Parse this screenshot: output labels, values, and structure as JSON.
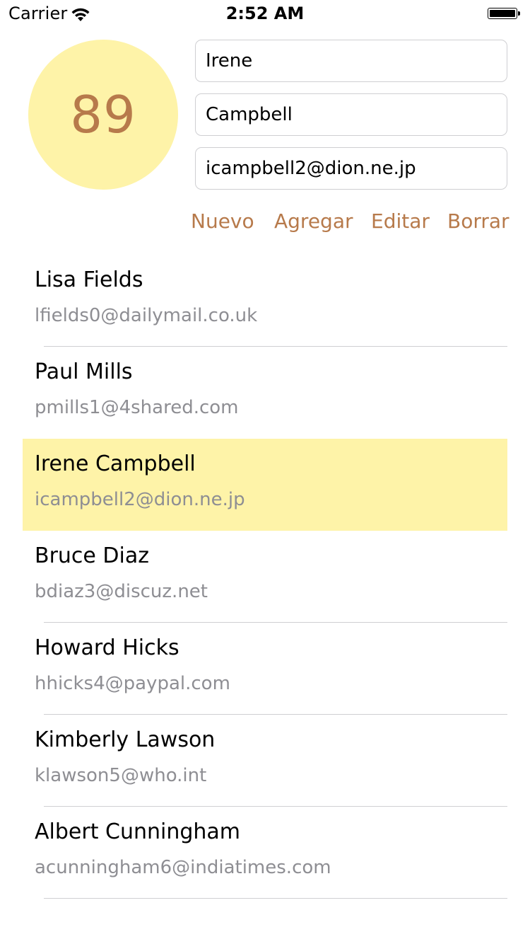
{
  "status_bar": {
    "carrier": "Carrier",
    "time": "2:52 AM",
    "wifi_icon": "wifi-icon",
    "battery_icon": "battery-icon",
    "battery_level": 1.0
  },
  "colors": {
    "accent": "#b77a4b",
    "highlight": "#fef3a8",
    "secondary_text": "#8e8e93",
    "separator": "#cfcfd2"
  },
  "avatar": {
    "number": "89"
  },
  "form": {
    "first_name": "Irene",
    "last_name": "Campbell",
    "email": "icampbell2@dion.ne.jp"
  },
  "actions": {
    "new_label": "Nuevo",
    "add_label": "Agregar",
    "edit_label": "Editar",
    "delete_label": "Borrar"
  },
  "contacts": [
    {
      "name": "Lisa Fields",
      "email": "lfields0@dailymail.co.uk",
      "selected": false
    },
    {
      "name": "Paul Mills",
      "email": "pmills1@4shared.com",
      "selected": false
    },
    {
      "name": "Irene Campbell",
      "email": "icampbell2@dion.ne.jp",
      "selected": true
    },
    {
      "name": "Bruce Diaz",
      "email": "bdiaz3@discuz.net",
      "selected": false
    },
    {
      "name": "Howard Hicks",
      "email": "hhicks4@paypal.com",
      "selected": false
    },
    {
      "name": "Kimberly Lawson",
      "email": "klawson5@who.int",
      "selected": false
    },
    {
      "name": "Albert Cunningham",
      "email": "acunningham6@indiatimes.com",
      "selected": false
    }
  ]
}
